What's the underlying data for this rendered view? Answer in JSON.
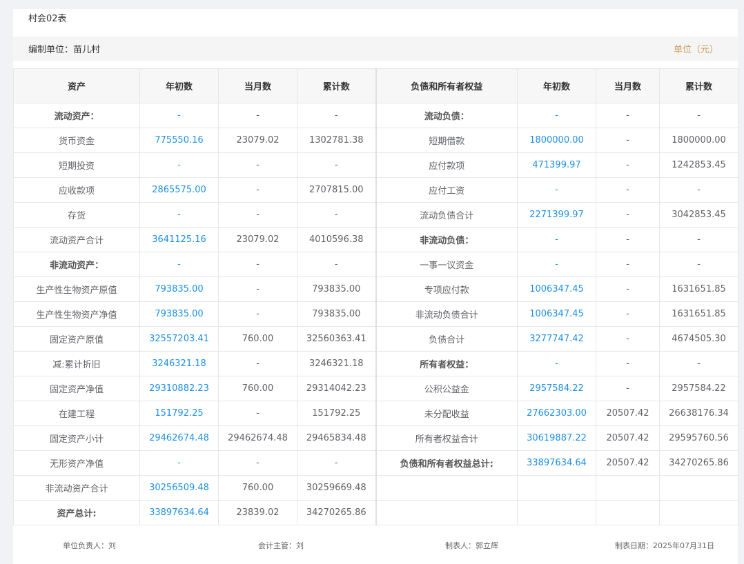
{
  "title": "村会02表",
  "unit_bar": {
    "org_label": "编制单位：苗儿村",
    "unit_label": "单位（元）"
  },
  "headers": [
    "资产",
    "年初数",
    "当月数",
    "累计数",
    "负债和所有者权益",
    "年初数",
    "当月数",
    "累计数"
  ],
  "rows": [
    [
      "流动资产：",
      "-",
      "-",
      "-",
      "流动负债：",
      "-",
      "-",
      "-"
    ],
    [
      "货币资金",
      "775550.16",
      "23079.02",
      "1302781.38",
      "短期借款",
      "1800000.00",
      "-",
      "1800000.00"
    ],
    [
      "短期投资",
      "-",
      "-",
      "-",
      "应付款项",
      "471399.97",
      "-",
      "1242853.45"
    ],
    [
      "应收款项",
      "2865575.00",
      "-",
      "2707815.00",
      "应付工资",
      "-",
      "-",
      "-"
    ],
    [
      "存货",
      "-",
      "-",
      "-",
      "流动负债合计",
      "2271399.97",
      "-",
      "3042853.45"
    ],
    [
      "流动资产合计",
      "3641125.16",
      "23079.02",
      "4010596.38",
      "非流动负债：",
      "-",
      "-",
      "-"
    ],
    [
      "非流动资产：",
      "-",
      "-",
      "-",
      "一事一议资金",
      "-",
      "-",
      "-"
    ],
    [
      "生产性生物资产原值",
      "793835.00",
      "-",
      "793835.00",
      "专项应付款",
      "1006347.45",
      "-",
      "1631651.85"
    ],
    [
      "生产性生物资产净值",
      "793835.00",
      "-",
      "793835.00",
      "非流动负债合计",
      "1006347.45",
      "-",
      "1631651.85"
    ],
    [
      "固定资产原值",
      "32557203.41",
      "760.00",
      "32560363.41",
      "负债合计",
      "3277747.42",
      "-",
      "4674505.30"
    ],
    [
      "减:累计折旧",
      "3246321.18",
      "-",
      "3246321.18",
      "所有者权益：",
      "-",
      "-",
      "-"
    ],
    [
      "固定资产净值",
      "29310882.23",
      "760.00",
      "29314042.23",
      "公积公益金",
      "2957584.22",
      "-",
      "2957584.22"
    ],
    [
      "在建工程",
      "151792.25",
      "-",
      "151792.25",
      "未分配收益",
      "27662303.00",
      "20507.42",
      "26638176.34"
    ],
    [
      "固定资产小计",
      "29462674.48",
      "29462674.48",
      "29465834.48",
      "所有者权益合计",
      "30619887.22",
      "20507.42",
      "29595760.56"
    ],
    [
      "无形资产净值",
      "-",
      "-",
      "-",
      "负债和所有者权益总计:",
      "33897634.64",
      "20507.42",
      "34270265.86"
    ],
    [
      "非流动资产合计",
      "30256509.48",
      "760.00",
      "30259669.48",
      "",
      "",
      "",
      ""
    ],
    [
      "资产总计:",
      "33897634.64",
      "23839.02",
      "34270265.86",
      "",
      "",
      "",
      ""
    ]
  ],
  "bold_left_rows": [
    0,
    6,
    16
  ],
  "bold_right_rows": [
    0,
    5,
    10,
    14
  ],
  "footer": {
    "responsible": "单位负责人：刘",
    "accountant": "会计主管：刘",
    "preparer": "制表人：郭立辉",
    "date": "制表日期：2025年07月31日"
  }
}
